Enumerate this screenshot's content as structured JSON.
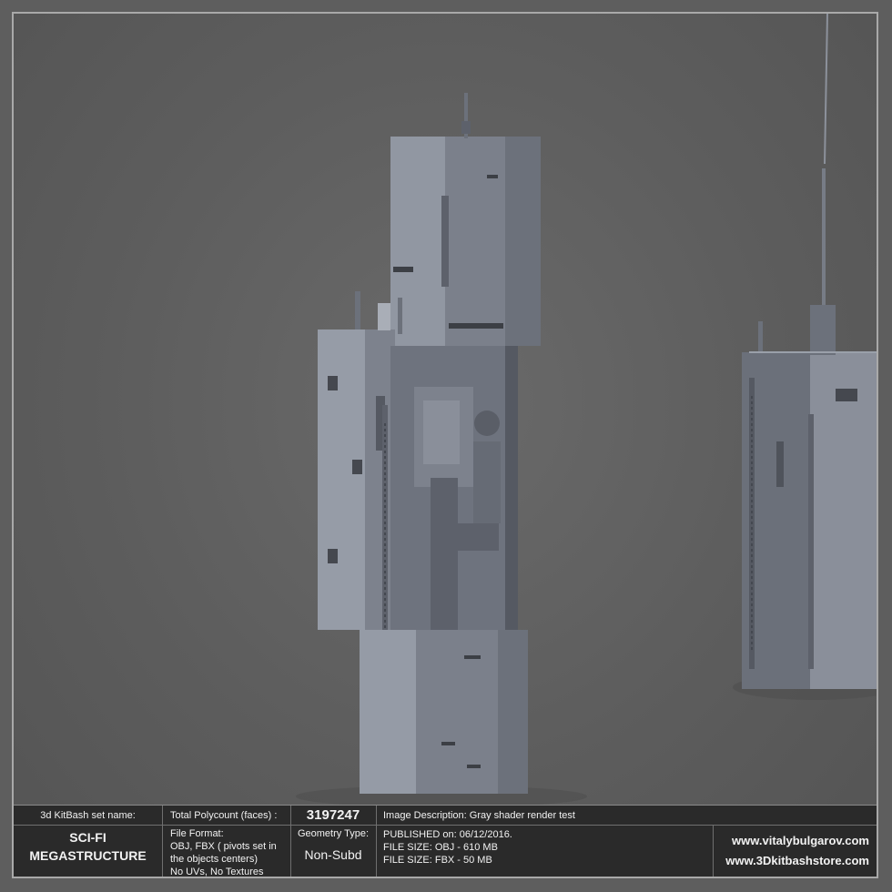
{
  "scene": {
    "description_image": "gray-shader-render-of-kitbash-towers"
  },
  "info": {
    "set_name_label": "3d KitBash set name:",
    "set_name_line1": "SCI-FI",
    "set_name_line2": "MEGASTRUCTURE",
    "polycount_label": "Total Polycount (faces) :",
    "polycount_value": "3197247",
    "file_format_label": "File Format:",
    "file_format_line1": "OBJ, FBX ( pivots set in",
    "file_format_line2": "the objects centers)",
    "file_format_line3": "No UVs, No Textures",
    "geometry_label": "Geometry Type:",
    "geometry_value": "Non-Subd",
    "image_description": "Image Description: Gray shader render test",
    "published": "PUBLISHED on: 06/12/2016.",
    "size_obj": "FILE SIZE: OBJ - 610 MB",
    "size_fbx": "FILE SIZE: FBX - 50 MB",
    "url1": "www.vitalybulgarov.com",
    "url2": "www.3Dkitbashstore.com"
  },
  "colors": {
    "background": "#5e5e5e",
    "tower_light": "#8a8f9a",
    "tower_dark": "#5c606a",
    "panel": "#2a2a2a"
  }
}
